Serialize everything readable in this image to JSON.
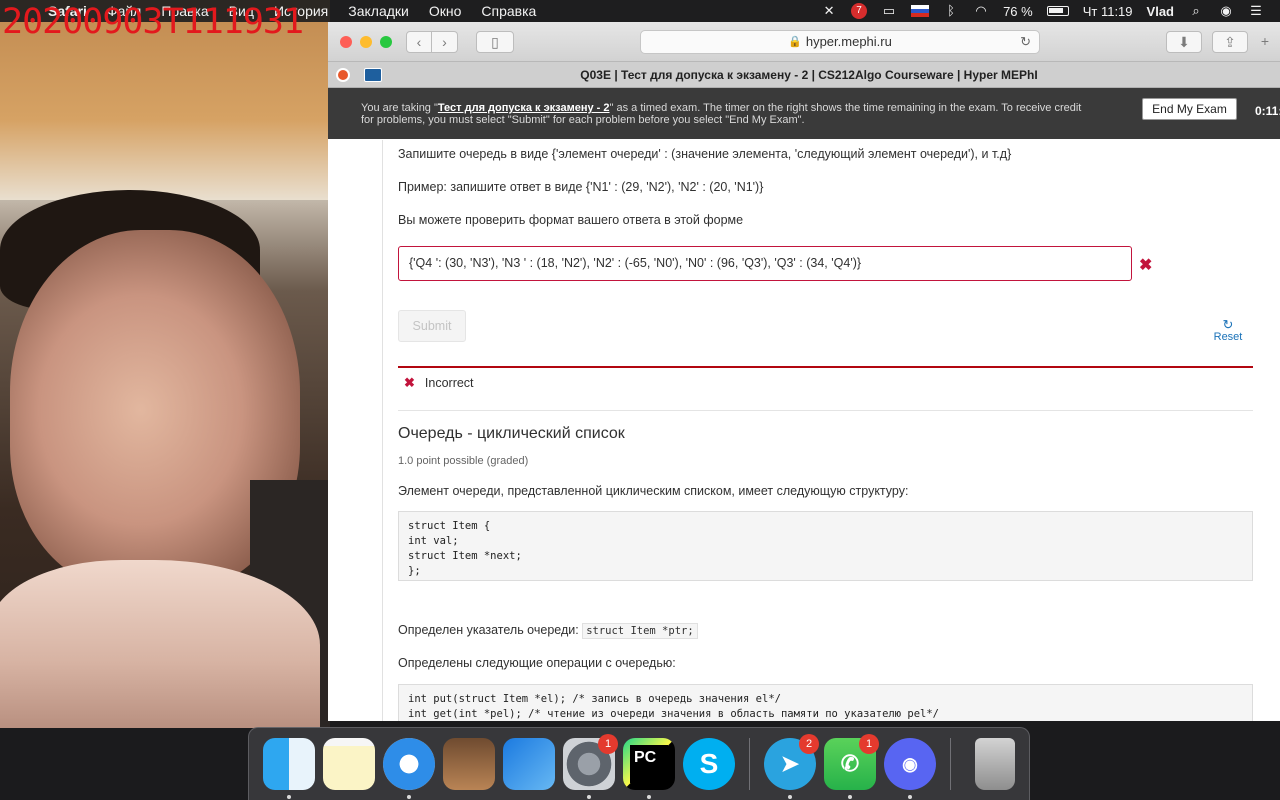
{
  "overlay": {
    "timestamp": "20200903T111931"
  },
  "menubar": {
    "apple": "",
    "app": "Safari",
    "menus": [
      "Файл",
      "Правка",
      "Вид",
      "История",
      "Закладки",
      "Окно",
      "Справка"
    ],
    "notification_count": "7",
    "battery": "76 %",
    "clock": "Чт 11:19",
    "user": "Vlad"
  },
  "browser": {
    "url": "hyper.mephi.ru",
    "tab_title": "Q03E | Тест для допуска к экзамену - 2 | CS212Algo Courseware | Hyper MEPhI"
  },
  "exam_banner": {
    "prefix": "You are taking \"",
    "exam_name": "Тест для допуска к экзамену - 2",
    "suffix": "\" as a timed exam. The timer on the right shows the time remaining in the exam. To receive credit for problems, you must select \"Submit\" for each problem before you select \"End My Exam\".",
    "end_button": "End My Exam",
    "timer": "0:11:"
  },
  "problem1": {
    "instruction": "Запишите очередь в виде {'элемент очереди' : (значение элемента, 'следующий элемент очереди'), и т.д}",
    "example": "Пример: запишите ответ в виде {'N1' : (29, 'N2'), 'N2' : (20, 'N1')}",
    "check_hint": "Вы можете проверить формат вашего ответа в этой форме",
    "answer": "{'Q4 ': (30, 'N3'), 'N3 ' : (18, 'N2'), 'N2' : (-65, 'N0'), 'N0' : (96, 'Q3'), 'Q3' : (34, 'Q4')}",
    "submit_label": "Submit",
    "reset_label": "Reset",
    "status": "Incorrect"
  },
  "problem2": {
    "title": "Очередь - циклический список",
    "points": "1.0 point possible (graded)",
    "intro": "Элемент очереди, представленной циклическим списком, имеет следующую структуру:",
    "struct_code": "struct Item {\nint val;\nstruct Item *next;\n};",
    "pointer_text": "Определен указатель очереди: ",
    "pointer_code": "struct Item *ptr;",
    "ops_intro": "Определены следующие операции с очередью:",
    "ops_code": "int put(struct Item *el); /* запись в очередь значения el*/\nint get(int *pel); /* чтение из очереди значения в область памяти по указателю pel*/"
  },
  "dock": {
    "apps": [
      {
        "name": "Finder"
      },
      {
        "name": "Notes"
      },
      {
        "name": "Safari"
      },
      {
        "name": "GarageBand"
      },
      {
        "name": "Xcode"
      },
      {
        "name": "System Preferences",
        "badge": "1"
      },
      {
        "name": "PyCharm",
        "label": "PC"
      },
      {
        "name": "Skype",
        "label": "S"
      },
      {
        "name": "Telegram",
        "badge": "2"
      },
      {
        "name": "FaceTime",
        "badge": "1"
      },
      {
        "name": "Discord"
      },
      {
        "name": "Trash"
      }
    ]
  }
}
